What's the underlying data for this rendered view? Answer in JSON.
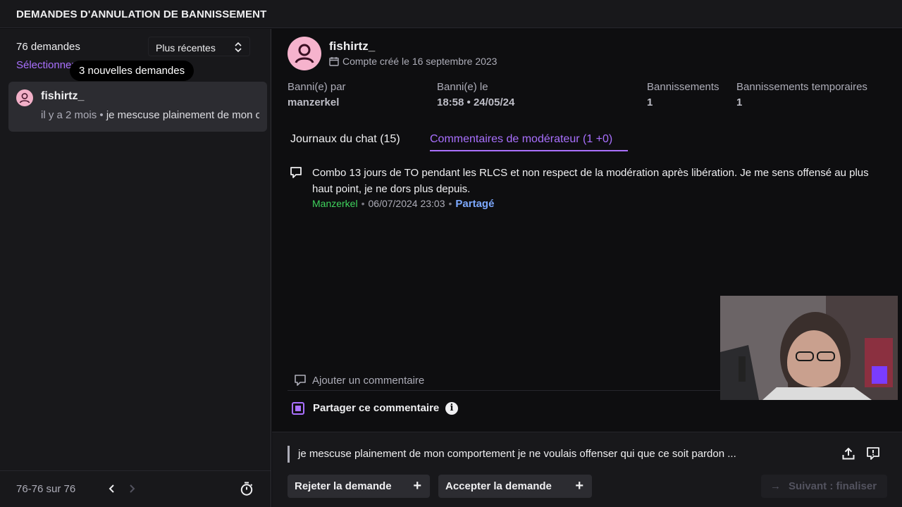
{
  "header": {
    "title": "DEMANDES D'ANNULATION DE BANNISSEMENT"
  },
  "sidebar": {
    "count": "76 demandes",
    "sort_label": "Plus récentes",
    "select_label": "Sélectionner",
    "tooltip": "3 nouvelles demandes",
    "items": [
      {
        "name": "fishirtz_",
        "age": "il y a 2 mois",
        "bullet": "•",
        "preview": "je mescuse plainement de mon comportement"
      }
    ],
    "pagination": "76-76 sur 76"
  },
  "user": {
    "name": "fishirtz_",
    "created": "Compte créé le 16 septembre 2023"
  },
  "stats": {
    "banned_by_label": "Banni(e) par",
    "banned_by_value": "manzerkel",
    "banned_on_label": "Banni(e) le",
    "banned_on_value": "18:58 • 24/05/24",
    "bans_label": "Bannissements",
    "bans_value": "1",
    "temp_bans_label": "Bannissements temporaires",
    "temp_bans_value": "1"
  },
  "tabs": {
    "chat": "Journaux du chat (15)",
    "mod": "Commentaires de modérateur (1 +0)"
  },
  "comment": {
    "text": "Combo 13 jours de TO pendant les RLCS et non respect de la modération après libération. Je me sens offensé au plus haut point, je ne dors plus depuis.",
    "author": "Manzerkel",
    "sep": "•",
    "date": "06/07/2024 23:03",
    "shared": "Partagé"
  },
  "compose": {
    "placeholder": "Ajouter un commentaire",
    "share_label": "Partager ce commentaire",
    "info": "i"
  },
  "request": {
    "message": "je mescuse plainement de mon comportement je ne voulais offenser qui que ce soit pardon ..."
  },
  "actions": {
    "reject": "Rejeter la demande",
    "accept": "Accepter la demande",
    "plus": "+",
    "next": "Suivant : finaliser",
    "next_arrow": "→"
  },
  "colors": {
    "accent": "#a970ff",
    "author": "#3fd35d",
    "shared": "#7da9ff",
    "avatar": "#f6b3cd"
  }
}
